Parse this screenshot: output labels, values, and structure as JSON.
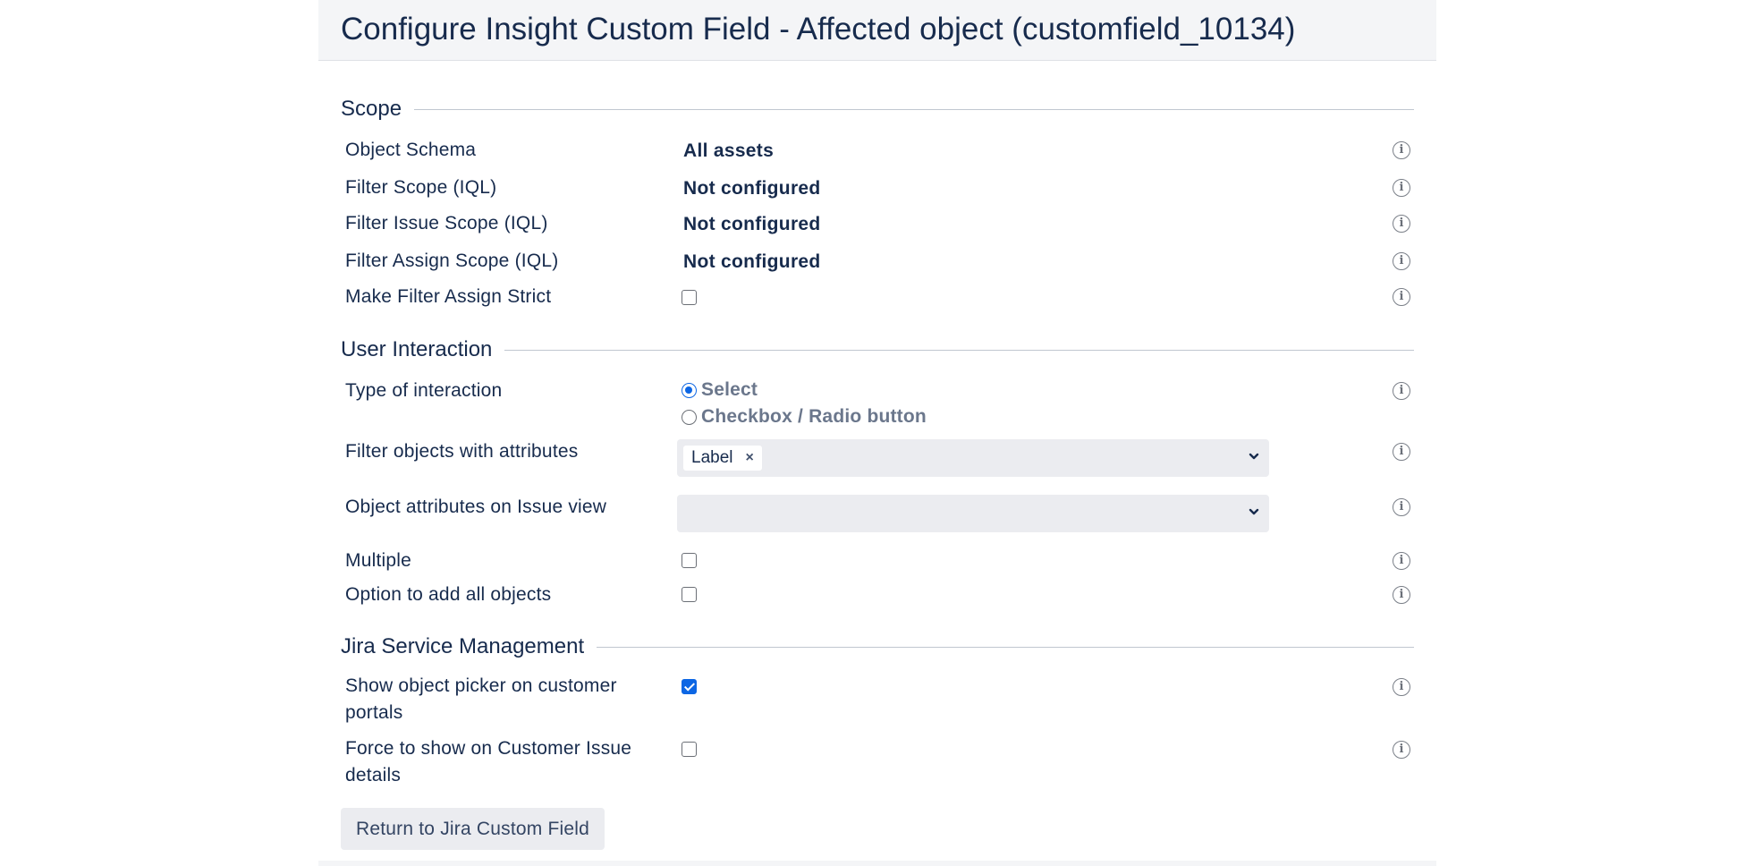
{
  "page": {
    "title": "Configure Insight Custom Field - Affected object (customfield_10134)"
  },
  "scope": {
    "heading": "Scope",
    "rows": [
      {
        "label": "Object Schema",
        "value": "All assets"
      },
      {
        "label": "Filter Scope (IQL)",
        "value": "Not configured"
      },
      {
        "label": "Filter Issue Scope (IQL)",
        "value": "Not configured"
      },
      {
        "label": "Filter Assign Scope (IQL)",
        "value": "Not configured"
      },
      {
        "label": "Make Filter Assign Strict",
        "checked": false
      }
    ]
  },
  "user_interaction": {
    "heading": "User Interaction",
    "type_label": "Type of interaction",
    "options": [
      {
        "label": "Select",
        "selected": true
      },
      {
        "label": "Checkbox / Radio button",
        "selected": false
      }
    ],
    "filter_attrs_label": "Filter objects with attributes",
    "filter_attrs_tags": [
      "Label"
    ],
    "filter_attrs_remove": "×",
    "issue_view_label": "Object attributes on Issue view",
    "issue_view_value": "",
    "multiple_label": "Multiple",
    "multiple_checked": false,
    "add_all_label": "Option to add all objects",
    "add_all_checked": false
  },
  "jsm": {
    "heading": "Jira Service Management",
    "show_picker_label": "Show object picker on customer portals",
    "show_picker_checked": true,
    "force_show_label": "Force to show on Customer Issue details",
    "force_show_checked": false
  },
  "actions": {
    "return_label": "Return to Jira Custom Field"
  },
  "icons": {
    "info": "info-icon",
    "chevron": "chevron-down-icon",
    "info_glyph": "i"
  },
  "colors": {
    "accent": "#0c66e4",
    "text": "#172b4d",
    "field_bg": "#ebecf0"
  }
}
